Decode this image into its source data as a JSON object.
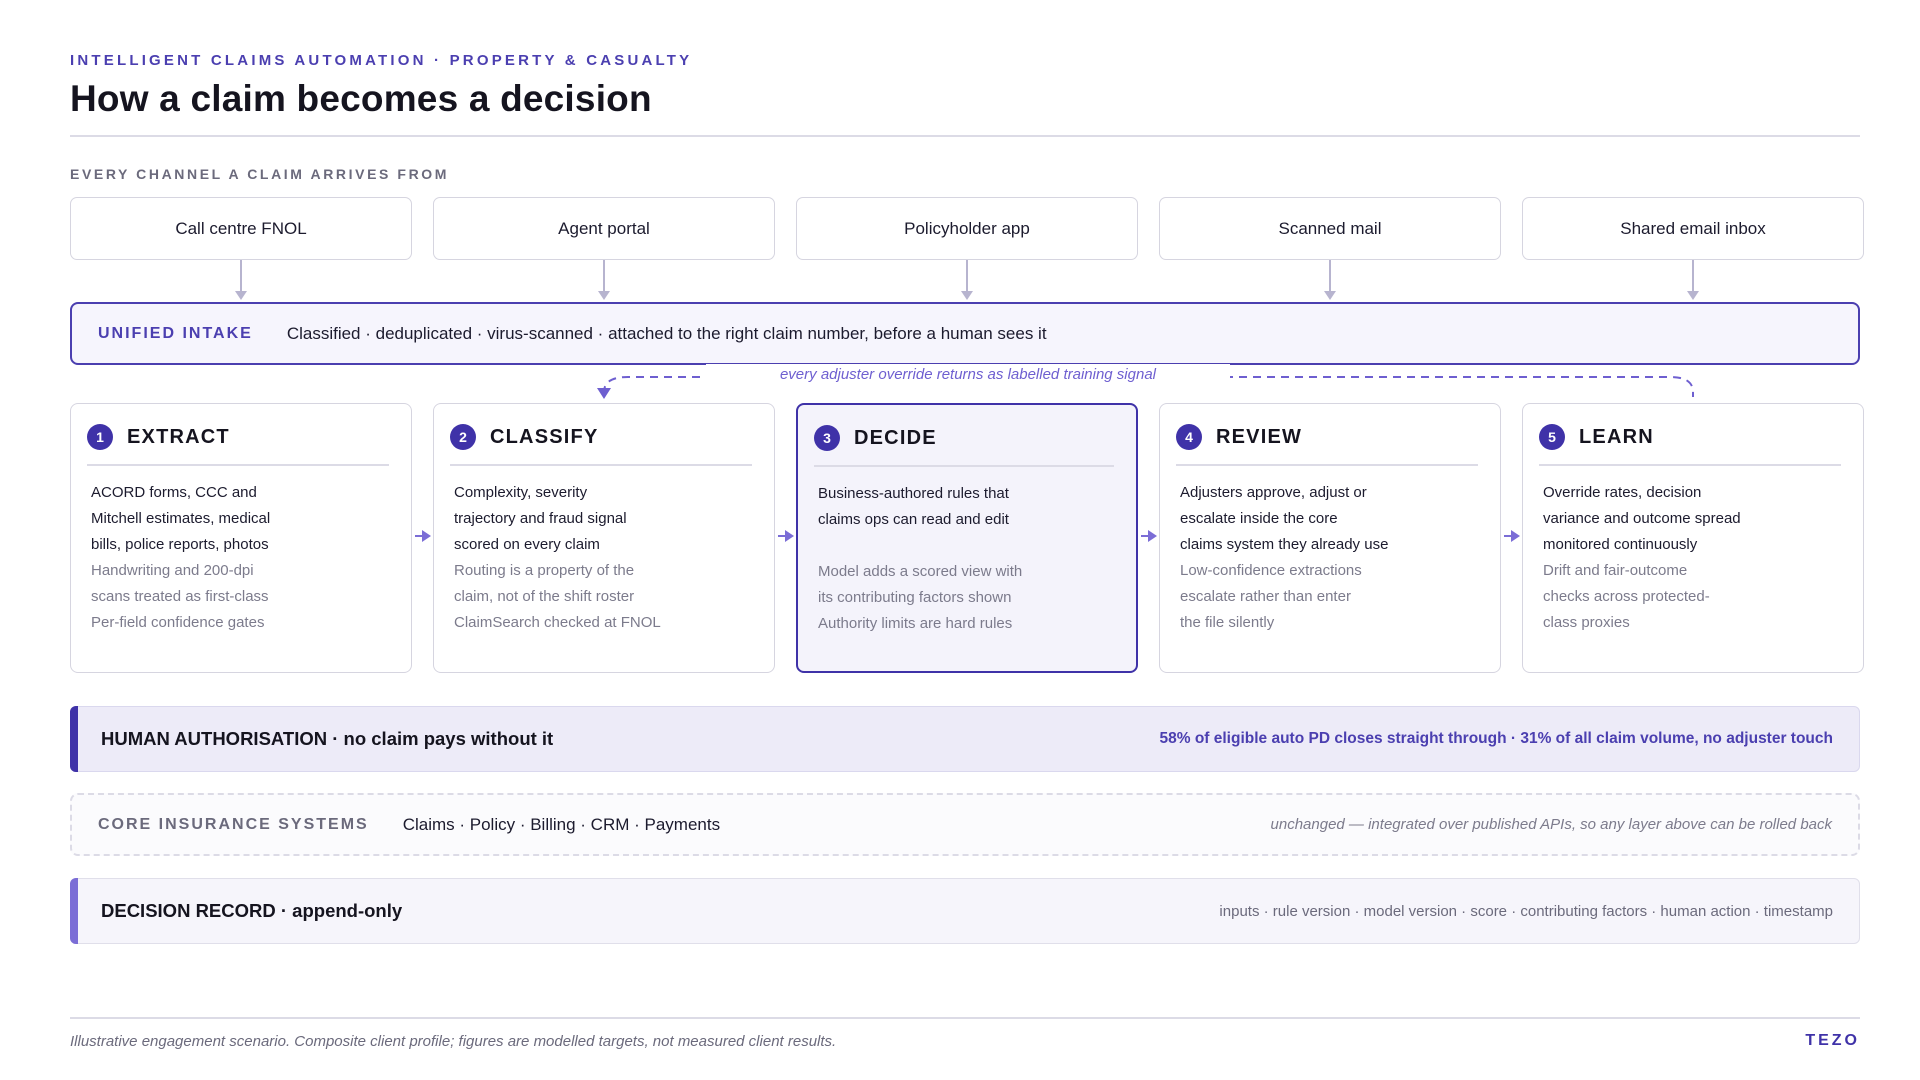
{
  "header": {
    "eyebrow": "INTELLIGENT CLAIMS AUTOMATION · PROPERTY & CASUALTY",
    "title": "How a claim becomes a decision"
  },
  "channels": {
    "label": "EVERY CHANNEL A CLAIM ARRIVES FROM",
    "items": [
      "Call centre FNOL",
      "Agent portal",
      "Policyholder app",
      "Scanned mail",
      "Shared email inbox"
    ]
  },
  "intake": {
    "tag": "UNIFIED INTAKE",
    "text": "Classified · deduplicated · virus-scanned · attached to the right claim number, before a human sees it"
  },
  "loop_note": "every adjuster override returns as labelled training signal",
  "stages": [
    {
      "num": "1",
      "name": "EXTRACT",
      "primary": [
        "ACORD forms, CCC and",
        "Mitchell estimates, medical",
        "bills, police reports, photos"
      ],
      "secondary": [
        "Handwriting and 200-dpi",
        "scans treated as first-class",
        "Per-field confidence gates"
      ]
    },
    {
      "num": "2",
      "name": "CLASSIFY",
      "primary": [
        "Complexity, severity",
        "trajectory and fraud signal",
        "scored on every claim"
      ],
      "secondary": [
        "Routing is a property of the",
        "claim, not of the shift roster",
        "ClaimSearch checked at FNOL"
      ]
    },
    {
      "num": "3",
      "name": "DECIDE",
      "primary": [
        "Business-authored rules that",
        "claims ops can read and edit"
      ],
      "secondary": [
        "Model adds a scored view with",
        "its contributing factors shown",
        "Authority limits are hard rules"
      ]
    },
    {
      "num": "4",
      "name": "REVIEW",
      "primary": [
        "Adjusters approve, adjust or",
        "escalate inside the core",
        "claims system they already use"
      ],
      "secondary": [
        "Low-confidence extractions",
        "escalate rather than enter",
        "the file silently"
      ]
    },
    {
      "num": "5",
      "name": "LEARN",
      "primary": [
        "Override rates, decision",
        "variance and outcome spread",
        "monitored continuously"
      ],
      "secondary": [
        "Drift and fair-outcome",
        "checks across protected-",
        "class proxies"
      ]
    }
  ],
  "authorisation": {
    "left": "HUMAN AUTHORISATION · no claim pays without it",
    "right": "58% of eligible auto PD closes straight through · 31% of all claim volume, no adjuster touch"
  },
  "core_systems": {
    "tag": "CORE INSURANCE SYSTEMS",
    "text": "Claims · Policy · Billing · CRM · Payments",
    "note": "unchanged — integrated over published APIs, so any layer above can be rolled back"
  },
  "decision_record": {
    "left": "DECISION RECORD · append-only",
    "right": "inputs · rule version · model version · score · contributing factors · human action · timestamp"
  },
  "footer": {
    "note": "Illustrative engagement scenario. Composite client profile; figures are modelled targets, not measured client results.",
    "brand": "TEZO"
  },
  "colors": {
    "accent": "#3f32a8",
    "accent_light": "#7b6dd6",
    "border": "#d6d5e0",
    "muted_text": "#7c7b8c"
  }
}
